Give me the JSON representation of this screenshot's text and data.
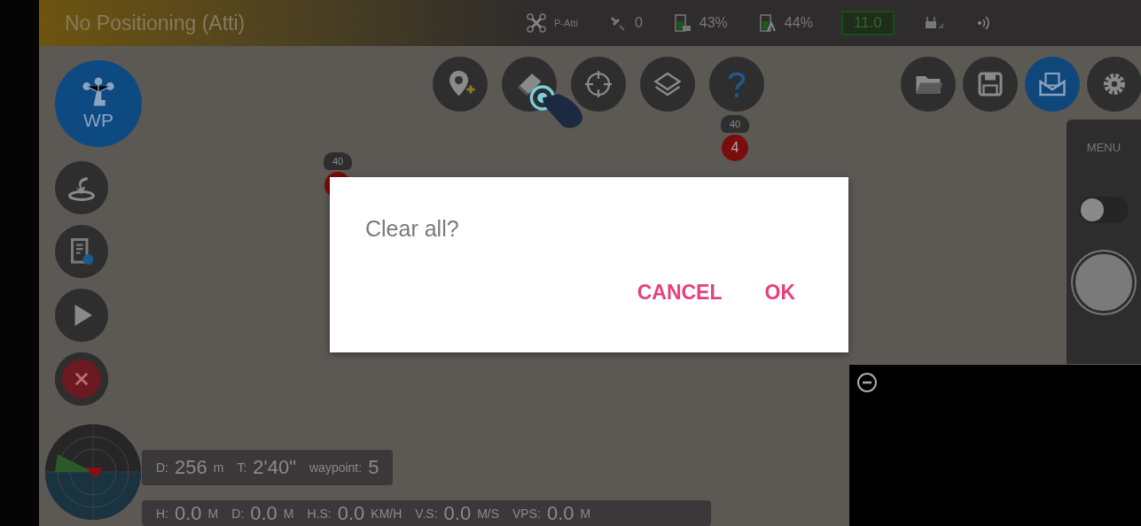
{
  "status_bar": {
    "mode": "No Positioning (Atti)",
    "flight_mode": "P-Atti",
    "satellites": "0",
    "aircraft_battery": "43%",
    "remote_battery": "44%",
    "voltage": "11.0"
  },
  "mode_button": {
    "label": "WP",
    "selected": true
  },
  "left_tools": [
    {
      "kind": "takeoff"
    },
    {
      "kind": "mission-settings"
    },
    {
      "kind": "play"
    },
    {
      "kind": "clear"
    }
  ],
  "top_tools": [
    {
      "kind": "add-point"
    },
    {
      "kind": "eraser"
    },
    {
      "kind": "target"
    },
    {
      "kind": "layers"
    },
    {
      "kind": "help"
    }
  ],
  "right_tools": [
    {
      "kind": "folder",
      "selected": false
    },
    {
      "kind": "save",
      "selected": false
    },
    {
      "kind": "inbox",
      "selected": true
    },
    {
      "kind": "settings",
      "selected": false
    }
  ],
  "waypoints": [
    {
      "altitude": "40"
    },
    {
      "altitude": "40",
      "number": "4"
    }
  ],
  "camera_panel": {
    "menu": "MENU",
    "toggle_on": false
  },
  "flight_info": [
    {
      "label": "D:",
      "value": "256",
      "unit": "m"
    },
    {
      "label": "T:",
      "value": "2'40\""
    },
    {
      "label": "waypoint:",
      "value": "5"
    }
  ],
  "telemetry": [
    {
      "label": "H:",
      "value": "0.0",
      "unit": "M"
    },
    {
      "label": "D:",
      "value": "0.0",
      "unit": "M"
    },
    {
      "label": "H.S:",
      "value": "0.0",
      "unit": "KM/H"
    },
    {
      "label": "V.S:",
      "value": "0.0",
      "unit": "M/S"
    },
    {
      "label": "VPS:",
      "value": "0.0",
      "unit": "M"
    }
  ],
  "dialog": {
    "message": "Clear all?",
    "buttons": [
      "CANCEL",
      "OK"
    ]
  }
}
